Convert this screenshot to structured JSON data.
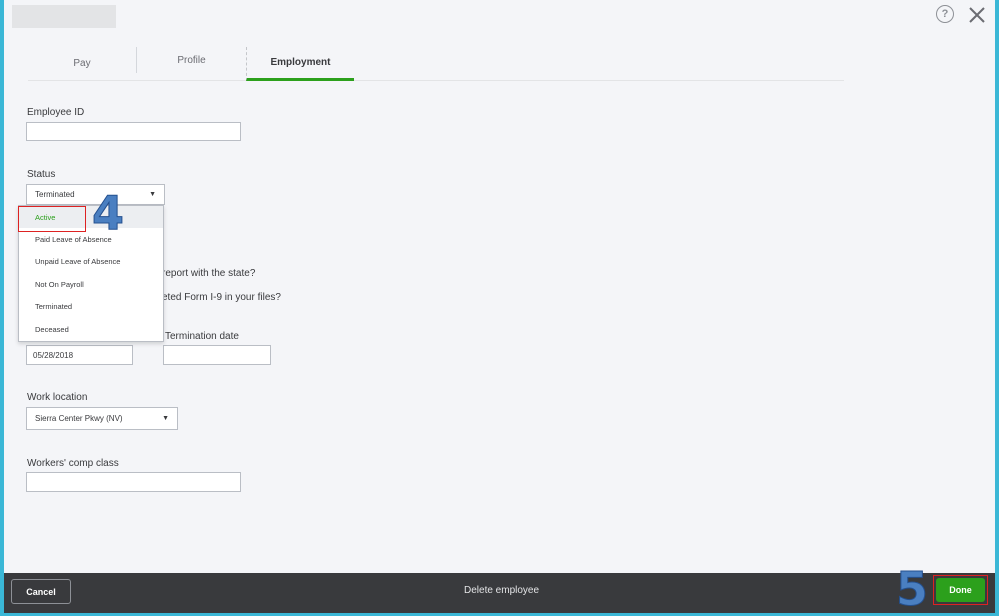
{
  "header": {
    "help_glyph": "?"
  },
  "tabs": [
    {
      "label": "Pay"
    },
    {
      "label": "Profile"
    },
    {
      "label": "Employment"
    }
  ],
  "form": {
    "employee_id": {
      "label": "Employee ID",
      "value": ""
    },
    "status": {
      "label": "Status",
      "selected": "Terminated",
      "options": [
        "Active",
        "Paid Leave of Absence",
        "Unpaid Leave of Absence",
        "Not On Payroll",
        "Terminated",
        "Deceased"
      ]
    },
    "question_1_fragment": "report with the state?",
    "question_2_fragment": "eted Form I-9 in your files?",
    "hire_date": {
      "value": "05/28/2018"
    },
    "termination_date": {
      "label": "Termination date",
      "value": ""
    },
    "work_location": {
      "label": "Work location",
      "selected": "Sierra Center Pkwy (NV)"
    },
    "workers_comp": {
      "label": "Workers' comp class",
      "value": ""
    }
  },
  "annotations": {
    "step_4": "4",
    "step_5": "5"
  },
  "footer": {
    "cancel_label": "Cancel",
    "delete_label": "Delete employee",
    "done_label": "Done"
  },
  "colors": {
    "accent": "#2ca01c",
    "footer_bg": "#393a3d",
    "annotation_red": "#dd2222",
    "annotation_blue": "#4a7fc1"
  }
}
